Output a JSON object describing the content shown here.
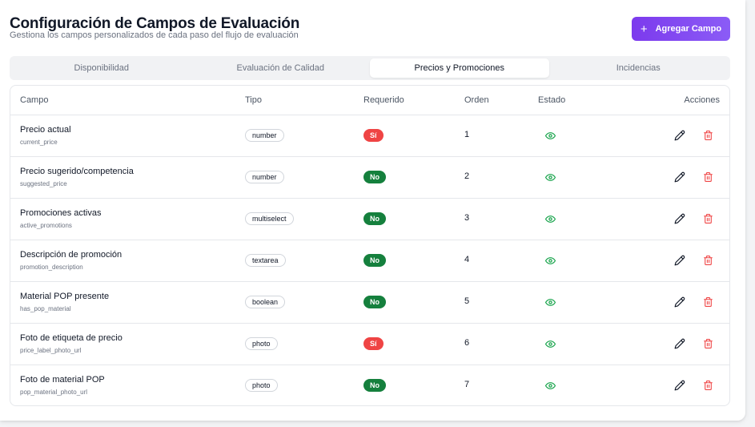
{
  "header": {
    "title": "Configuración de Campos de Evaluación",
    "subtitle": "Gestiona los campos personalizados de cada paso del flujo de evaluación",
    "add_button_label": "Agregar Campo",
    "add_button_icon": "plus-icon"
  },
  "tabs": [
    {
      "label": "Disponibilidad",
      "active": false
    },
    {
      "label": "Evaluación de Calidad",
      "active": false
    },
    {
      "label": "Precios y Promociones",
      "active": true
    },
    {
      "label": "Incidencias",
      "active": false
    }
  ],
  "table": {
    "columns": [
      "Campo",
      "Tipo",
      "Requerido",
      "Orden",
      "Estado",
      "Acciones"
    ],
    "rows": [
      {
        "name": "Precio actual",
        "key": "current_price",
        "type": "number",
        "required": "Sí",
        "order": "1"
      },
      {
        "name": "Precio sugerido/competencia",
        "key": "suggested_price",
        "type": "number",
        "required": "No",
        "order": "2"
      },
      {
        "name": "Promociones activas",
        "key": "active_promotions",
        "type": "multiselect",
        "required": "No",
        "order": "3"
      },
      {
        "name": "Descripción de promoción",
        "key": "promotion_description",
        "type": "textarea",
        "required": "No",
        "order": "4"
      },
      {
        "name": "Material POP presente",
        "key": "has_pop_material",
        "type": "boolean",
        "required": "No",
        "order": "5"
      },
      {
        "name": "Foto de etiqueta de precio",
        "key": "price_label_photo_url",
        "type": "photo",
        "required": "Sí",
        "order": "6"
      },
      {
        "name": "Foto de material POP",
        "key": "pop_material_photo_url",
        "type": "photo",
        "required": "No",
        "order": "7"
      }
    ],
    "status_icon": "eye-icon",
    "action_icons": [
      "edit-icon",
      "trash-icon"
    ]
  },
  "colors": {
    "accent": "#7c3aed",
    "required_yes": "#ef4444",
    "required_no": "#15803d",
    "status_active": "#16a34a",
    "delete": "#ef4444"
  }
}
